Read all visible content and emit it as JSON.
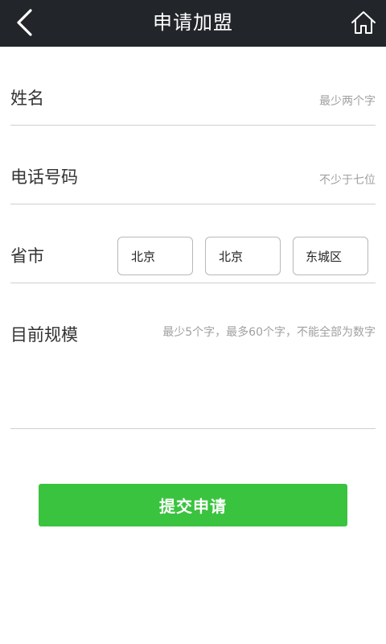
{
  "header": {
    "title": "申请加盟",
    "back_icon": "chevron-left-icon",
    "home_icon": "home-icon",
    "background": "#22262a"
  },
  "form": {
    "name": {
      "label": "姓名",
      "placeholder": "最少两个字",
      "value": ""
    },
    "phone": {
      "label": "电话号码",
      "placeholder": "不少于七位",
      "value": ""
    },
    "region": {
      "label": "省市",
      "province": "北京",
      "city": "北京",
      "district": "东城区"
    },
    "scale": {
      "label": "目前规模",
      "placeholder": "最少5个字，最多60个字，不能全部为数字",
      "value": ""
    }
  },
  "submit": {
    "label": "提交申请",
    "color": "#3ac33f"
  }
}
